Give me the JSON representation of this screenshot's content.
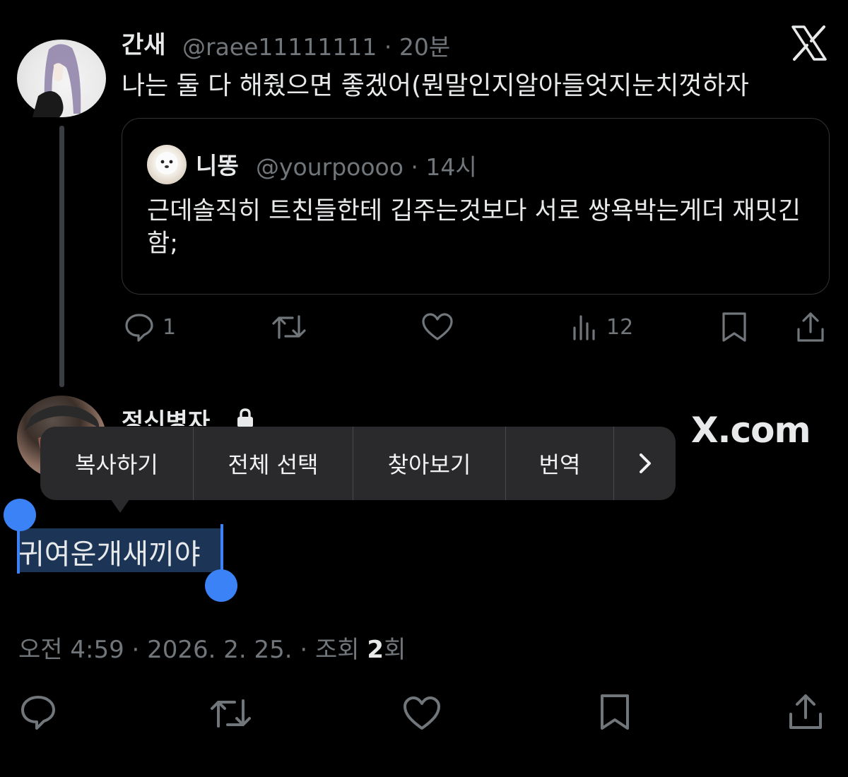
{
  "parent_tweet": {
    "display_name": "간새",
    "handle": "@raee11111111",
    "time": "20분",
    "text": "나는 둘 다 해줬으면 좋겠어(뭔말인지알아들엇지눈치껏하자",
    "quote": {
      "display_name": "니똥",
      "handle": "@yourpoooo",
      "time": "14시",
      "text": "근데솔직히 트친들한테 깁주는것보다 서로 쌍욕박는게더 재밋긴함;"
    },
    "actions": {
      "reply_count": "1",
      "views_count": "12"
    }
  },
  "reply_tweet": {
    "display_name": "정신병자",
    "selected_text": "귀여운개새끼야",
    "timestamp": "오전 4:59 · 2026. 2. 25. · 조회 ",
    "view_count": "2",
    "view_suffix": "회"
  },
  "watermark": "X.com",
  "context_menu": {
    "items": [
      "복사하기",
      "전체 선택",
      "찾아보기",
      "번역"
    ],
    "more_icon": "chevron-right-icon"
  },
  "icons": [
    "x-logo-icon",
    "reply-icon",
    "repost-icon",
    "like-icon",
    "views-icon",
    "bookmark-icon",
    "share-icon",
    "lock-icon"
  ],
  "colors": {
    "background": "#000000",
    "text": "#e7e9ea",
    "muted": "#71767b",
    "selection": "#3b82f6",
    "menu": "#2a2a2c"
  }
}
